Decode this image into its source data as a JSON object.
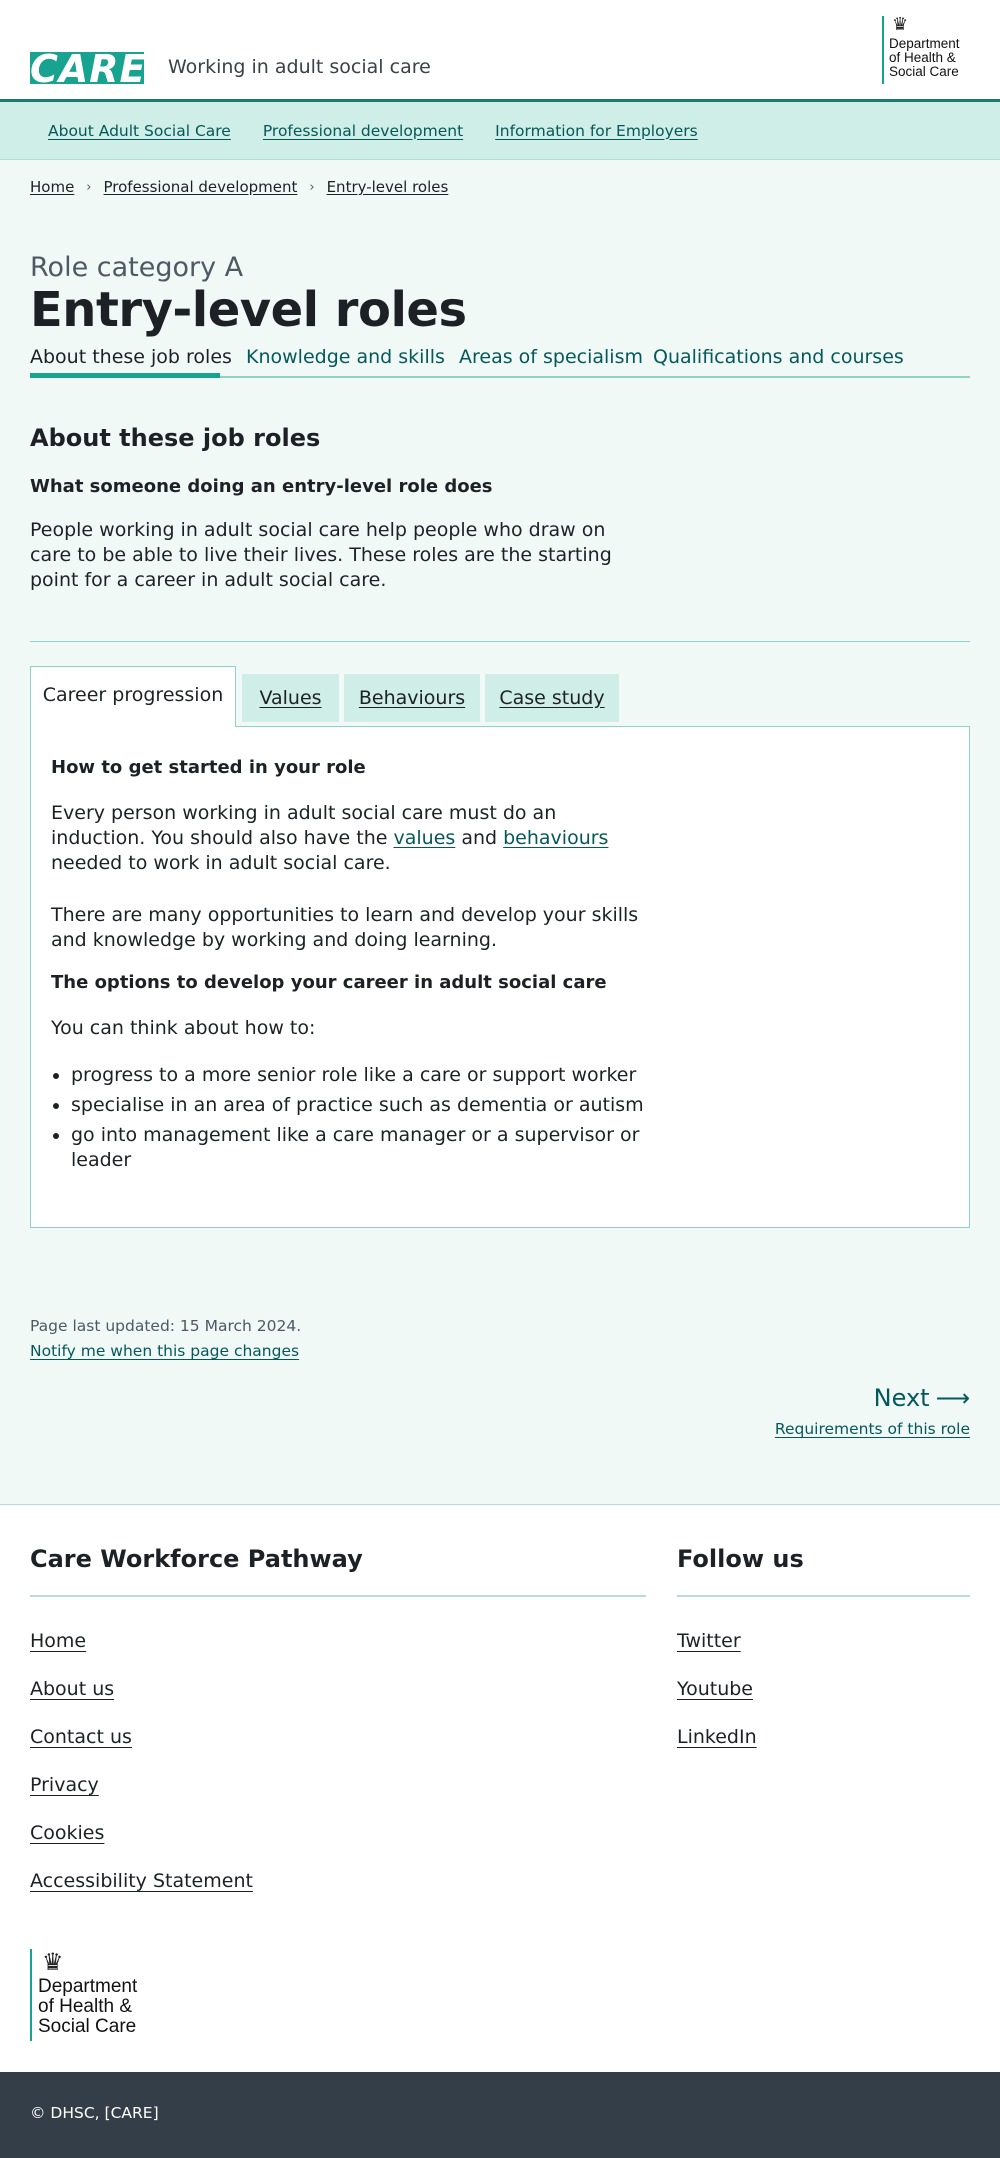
{
  "header": {
    "logo_text": "CARE",
    "site_name": "Working in adult social care",
    "org_logo_lines": [
      "Department",
      "of Health &",
      "Social Care"
    ]
  },
  "primary_nav": [
    "About Adult Social Care",
    "Professional development",
    "Information for Employers"
  ],
  "breadcrumb": [
    "Home",
    "Professional development",
    "Entry-level roles"
  ],
  "page": {
    "caption": "Role category A",
    "title": "Entry-level roles"
  },
  "subnav": {
    "items": [
      "About these job roles",
      "Knowledge and skills",
      "Areas of specialism",
      "Qualifications and courses"
    ],
    "current": "About these job roles"
  },
  "about": {
    "heading": "About these job roles",
    "subheading": "What someone doing an entry-level role does",
    "text": "People working in adult social care help people who draw on care to be able to live their lives. These roles are the starting point for a career in adult social care."
  },
  "tabs": {
    "items": [
      "Career progression",
      "Values",
      "Behaviours",
      "Case study"
    ],
    "active": "Career progression",
    "panel": {
      "heading1": "How to get started in your role",
      "para1_before": "Every person working in adult social care must do an induction. You should also have the ",
      "para1_link1": "values",
      "para1_mid": " and ",
      "para1_link2": "behaviours",
      "para1_after": " needed to work in adult social care.",
      "para2": "There are many opportunities to learn and develop your skills and knowledge by working and doing learning.",
      "heading2": "The options to develop your career in adult social care",
      "para3": "You can think about how to:",
      "bullets": [
        "progress to a more senior role like a care or support worker",
        "specialise in an area of practice such as dementia or autism",
        "go into management like a care manager or a supervisor or leader"
      ]
    }
  },
  "meta": {
    "updated": "Page last updated: 15 March 2024.",
    "notify": "Notify me when this page changes"
  },
  "pagination": {
    "label": "Next",
    "arrow": "⟶",
    "sub": "Requirements of this role"
  },
  "footer": {
    "col1_heading": "Care Workforce Pathway",
    "col1_links": [
      "Home",
      "About us",
      "Contact us",
      "Privacy",
      "Cookies",
      "Accessibility Statement"
    ],
    "col2_heading": "Follow us",
    "col2_links": [
      "Twitter",
      "Youtube",
      "LinkedIn"
    ],
    "copyright": "© DHSC, [CARE]"
  }
}
